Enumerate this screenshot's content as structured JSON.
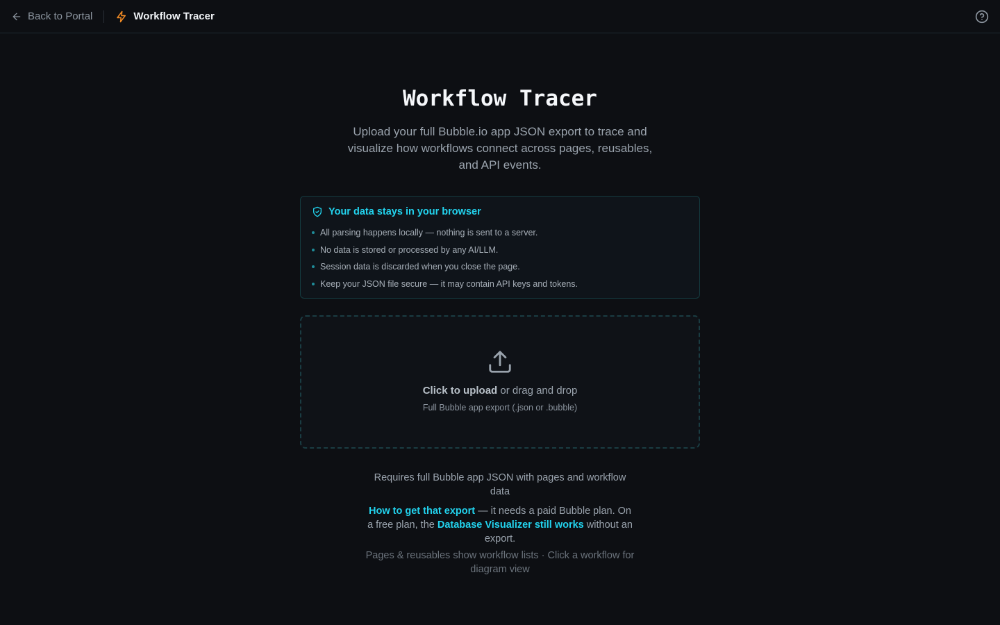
{
  "header": {
    "back_label": "Back to Portal",
    "app_title": "Workflow Tracer",
    "accent_color": "#f08a24"
  },
  "hero": {
    "title": "Workflow Tracer",
    "subtitle": "Upload your full Bubble.io app JSON export to trace and visualize how workflows connect across pages, reusables, and API events."
  },
  "privacy": {
    "title": "Your data stays in your browser",
    "items": [
      "All parsing happens locally — nothing is sent to a server.",
      "No data is stored or processed by any AI/LLM.",
      "Session data is discarded when you close the page.",
      "Keep your JSON file secure — it may contain API keys and tokens."
    ],
    "accent_color": "#22d3ee"
  },
  "upload": {
    "click_label": "Click to upload",
    "drag_label": " or drag and drop",
    "hint": "Full Bubble app export (.json or .bubble)"
  },
  "info": {
    "requirement": "Requires full Bubble app JSON with pages and workflow data",
    "export_link": "How to get that export",
    "export_text_1": " — it needs a paid Bubble plan. On a free plan, the ",
    "visualizer_link": "Database Visualizer still works",
    "export_text_2": " without an export.",
    "footnote": "Pages & reusables show workflow lists · Click a workflow for diagram view"
  },
  "icons": {
    "back": "arrow-left-icon",
    "brand": "lightning-bolt-icon",
    "help": "help-circle-icon",
    "privacy": "shield-check-icon",
    "upload": "upload-icon"
  }
}
